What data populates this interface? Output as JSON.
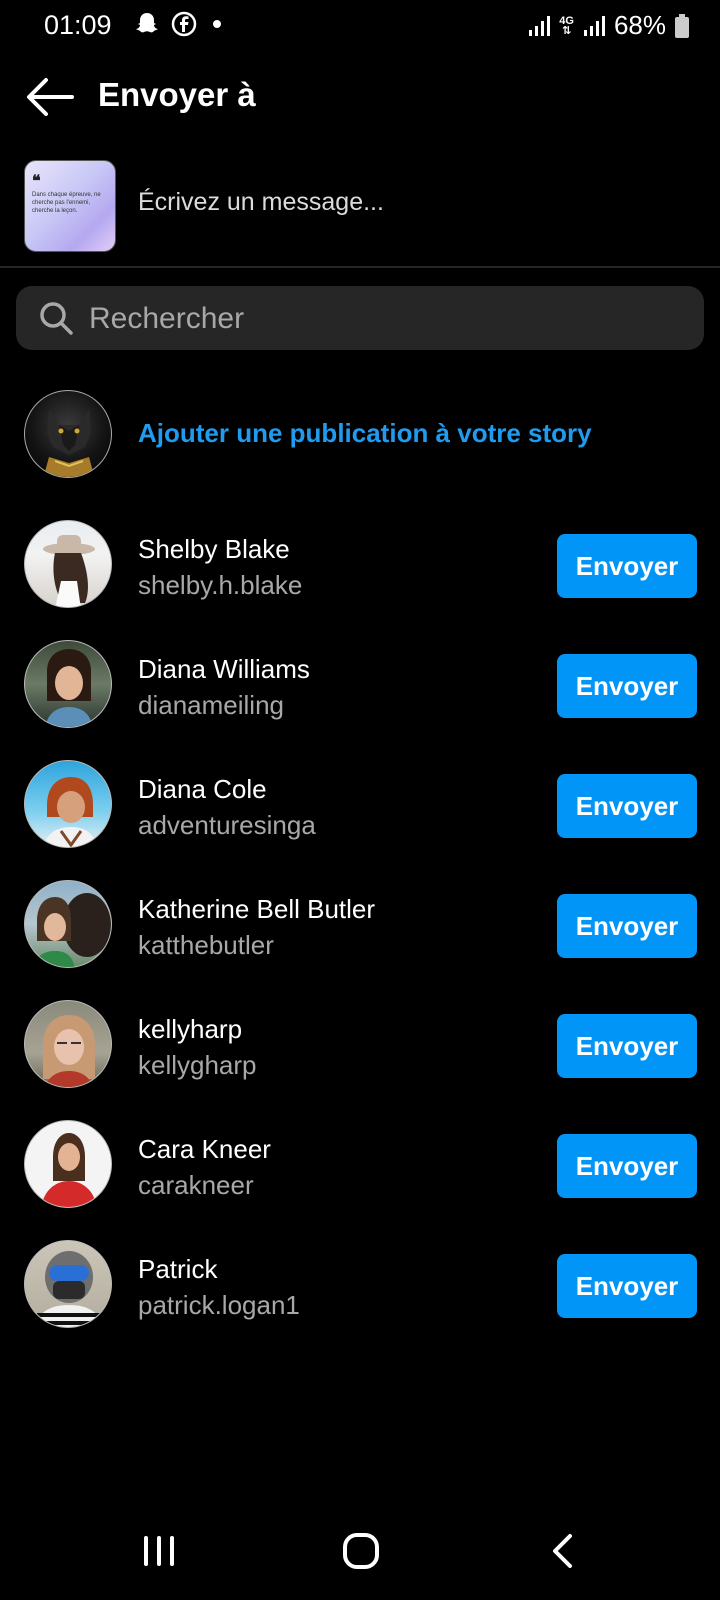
{
  "status_bar": {
    "time": "01:09",
    "network": "4G",
    "battery": "68%",
    "icons": [
      "snapchat-icon",
      "facebook-icon",
      "dot-icon",
      "signal-icon",
      "signal-icon",
      "battery-icon"
    ]
  },
  "header": {
    "title": "Envoyer à"
  },
  "compose": {
    "placeholder": "Écrivez un message...",
    "thumbnail_quote_mark": "❝",
    "thumbnail_text": "Dans chaque épreuve, ne cherche pas l'ennemi, cherche la leçon."
  },
  "search": {
    "placeholder": "Rechercher"
  },
  "story": {
    "label": "Ajouter une publication à votre story"
  },
  "contacts": [
    {
      "name": "Shelby Blake",
      "username": "shelby.h.blake",
      "button": "Envoyer"
    },
    {
      "name": "Diana Williams",
      "username": "dianameiling",
      "button": "Envoyer"
    },
    {
      "name": "Diana Cole",
      "username": "adventuresinga",
      "button": "Envoyer"
    },
    {
      "name": "Katherine Bell Butler",
      "username": "katthebutler",
      "button": "Envoyer"
    },
    {
      "name": "kellyharp",
      "username": "kellygharp",
      "button": "Envoyer"
    },
    {
      "name": "Cara Kneer",
      "username": "carakneer",
      "button": "Envoyer"
    },
    {
      "name": "Patrick",
      "username": "patrick.logan1",
      "button": "Envoyer"
    }
  ],
  "colors": {
    "accent": "#0095f6",
    "link": "#1f9bf0",
    "background": "#000000",
    "secondary_text": "#a8a8a8"
  }
}
